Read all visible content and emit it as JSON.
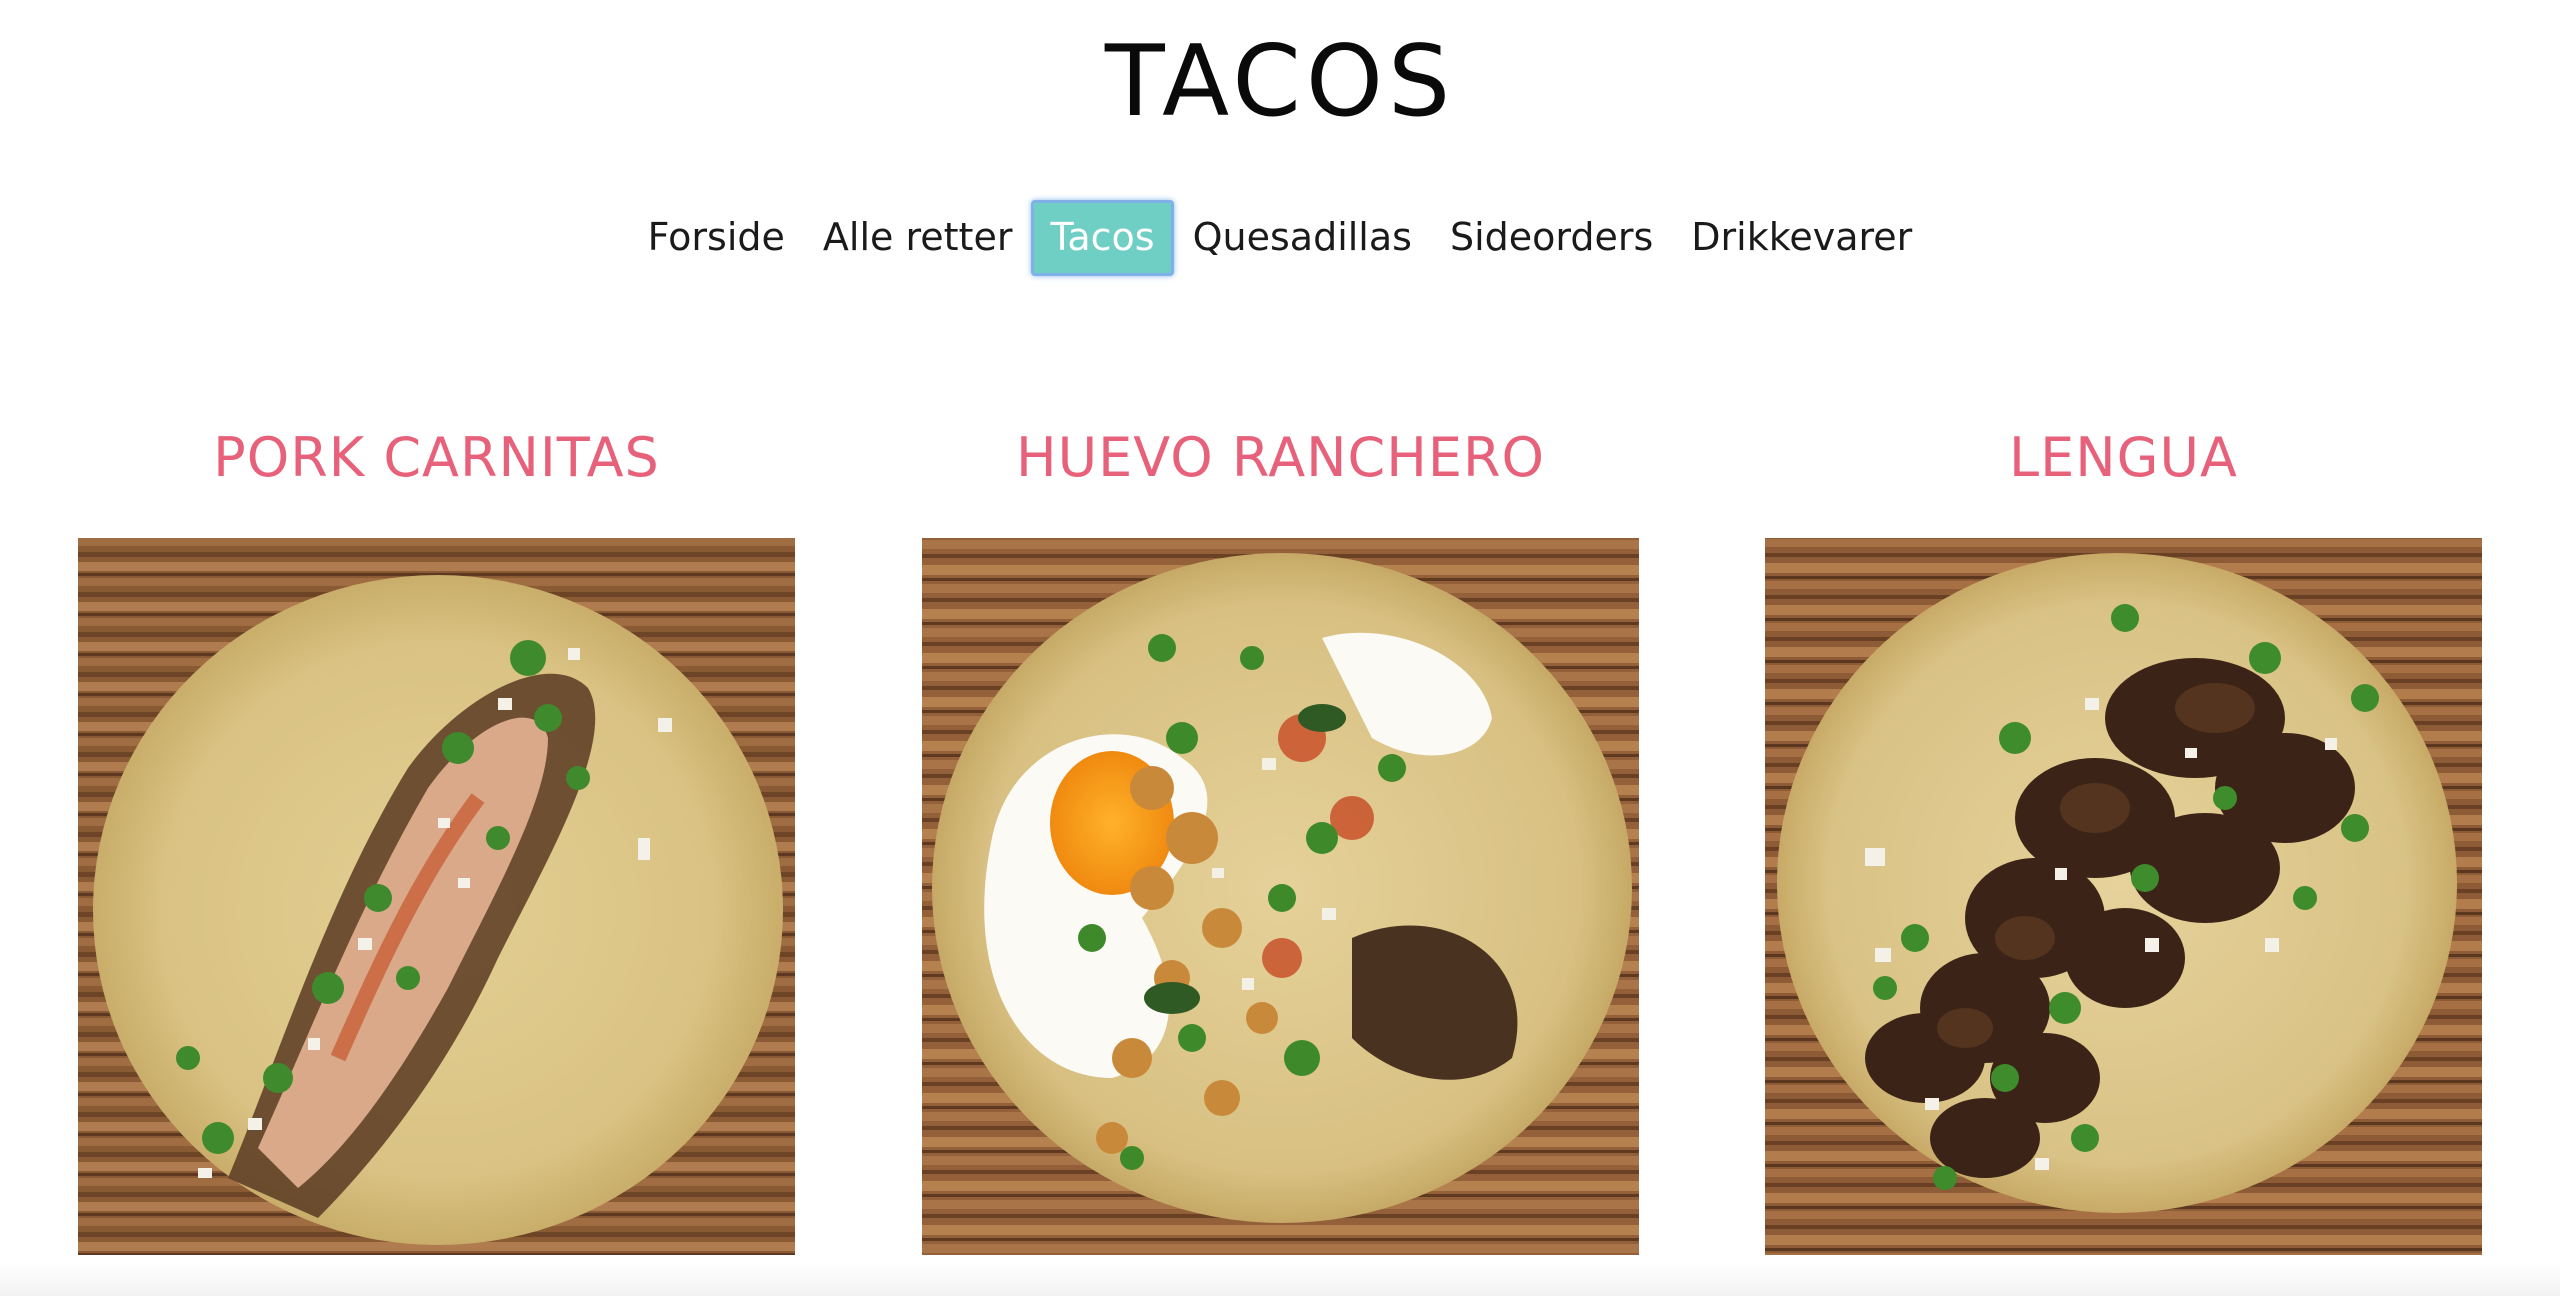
{
  "site": {
    "title": "TACOS"
  },
  "nav": {
    "items": [
      {
        "label": "Forside",
        "active": false
      },
      {
        "label": "Alle retter",
        "active": false
      },
      {
        "label": "Tacos",
        "active": true
      },
      {
        "label": "Quesadillas",
        "active": false
      },
      {
        "label": "Sideorders",
        "active": false
      },
      {
        "label": "Drikkevarer",
        "active": false
      }
    ]
  },
  "dishes": [
    {
      "title": "PORK CARNITAS",
      "image": "taco-pork-carnitas-photo"
    },
    {
      "title": "HUEVO RANCHERO",
      "image": "taco-huevo-ranchero-photo"
    },
    {
      "title": "LENGUA",
      "image": "taco-lengua-photo"
    }
  ],
  "colors": {
    "dish_title": "#e8617a",
    "nav_active_bg": "#6fcfc4",
    "nav_active_border": "#7fb0e6"
  }
}
